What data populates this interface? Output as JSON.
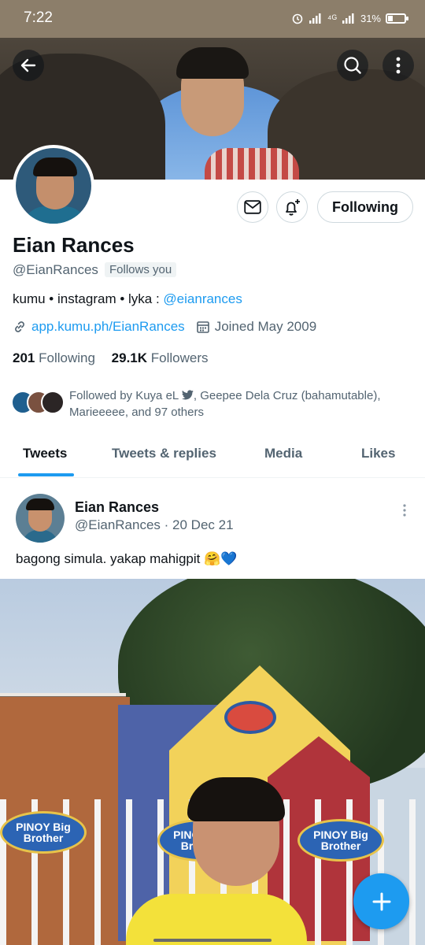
{
  "status_bar": {
    "time": "7:22",
    "network": "⁴ᴳ",
    "battery": "31%",
    "battery_level": 0.31
  },
  "header": {
    "back_icon": "arrow-left-icon",
    "search_icon": "search-icon",
    "more_icon": "more-vertical-icon"
  },
  "profile": {
    "name": "Eian Rances",
    "handle": "@EianRances",
    "follows_you": "Follows you",
    "bio_text": "kumu • instagram • lyka : ",
    "bio_link": "@eianrances",
    "website": "app.kumu.ph/EianRances",
    "joined": "Joined May 2009",
    "following_count": "201",
    "following_label": "Following",
    "followers_count": "29.1K",
    "followers_label": "Followers",
    "follow_button": "Following",
    "followed_by_1": "Followed by Kuya eL ",
    "followed_by_2": ", Geepee Dela Cruz (bahamutable), Marieeeee, and 97 others"
  },
  "tabs": [
    {
      "label": "Tweets",
      "active": true
    },
    {
      "label": "Tweets & replies",
      "active": false
    },
    {
      "label": "Media",
      "active": false
    },
    {
      "label": "Likes",
      "active": false
    }
  ],
  "tweet": {
    "name": "Eian Rances",
    "handle_date": "@EianRances · 20 Dec 21",
    "text": "bagong simula. yakap mahigpit 🤗💙",
    "media_sign_text": "PINOY Big Brother"
  },
  "colors": {
    "accent": "#1d9bf0",
    "text": "#0f1419",
    "muted": "#536471",
    "status_bar": "#8c7e6a"
  }
}
